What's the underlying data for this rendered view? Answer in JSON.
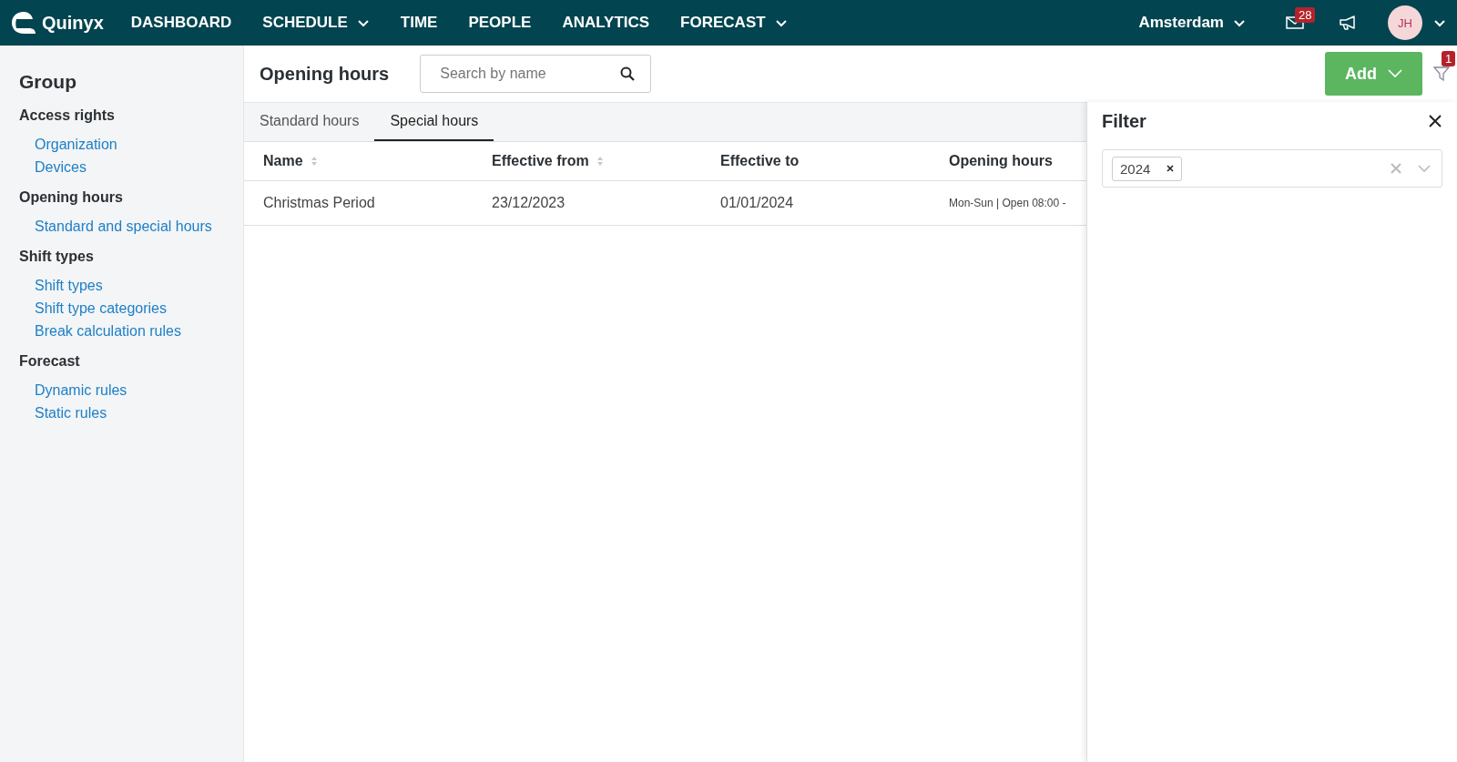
{
  "header": {
    "logo": "Quinyx",
    "nav": [
      {
        "label": "DASHBOARD",
        "dropdown": false
      },
      {
        "label": "SCHEDULE",
        "dropdown": true
      },
      {
        "label": "TIME",
        "dropdown": false
      },
      {
        "label": "PEOPLE",
        "dropdown": false
      },
      {
        "label": "ANALYTICS",
        "dropdown": false
      },
      {
        "label": "FORECAST",
        "dropdown": true
      }
    ],
    "location": "Amsterdam",
    "messages_badge": "28",
    "avatar": "JH"
  },
  "sidebar": {
    "title": "Group",
    "sections": [
      {
        "heading": "Access rights",
        "items": [
          "Organization",
          "Devices"
        ]
      },
      {
        "heading": "Opening hours",
        "items": [
          "Standard and special hours"
        ]
      },
      {
        "heading": "Shift types",
        "items": [
          "Shift types",
          "Shift type categories",
          "Break calculation rules"
        ]
      },
      {
        "heading": "Forecast",
        "items": [
          "Dynamic rules",
          "Static rules"
        ]
      }
    ]
  },
  "page": {
    "title": "Opening hours",
    "search": {
      "placeholder": "Search by name"
    },
    "add_button": "Add",
    "filter_badge": "1"
  },
  "tabs": [
    {
      "label": "Standard hours",
      "selected": false
    },
    {
      "label": "Special hours",
      "selected": true
    }
  ],
  "table": {
    "columns": [
      {
        "label": "Name",
        "sortable": true
      },
      {
        "label": "Effective from",
        "sortable": true
      },
      {
        "label": "Effective to",
        "sortable": false
      },
      {
        "label": "Opening hours",
        "sortable": false
      }
    ],
    "rows": [
      [
        "Christmas Period",
        "23/12/2023",
        "01/01/2024",
        "Mon-Sun | Open 08:00 -"
      ]
    ]
  },
  "filter_panel": {
    "title": "Filter",
    "chips": [
      "2024"
    ]
  }
}
